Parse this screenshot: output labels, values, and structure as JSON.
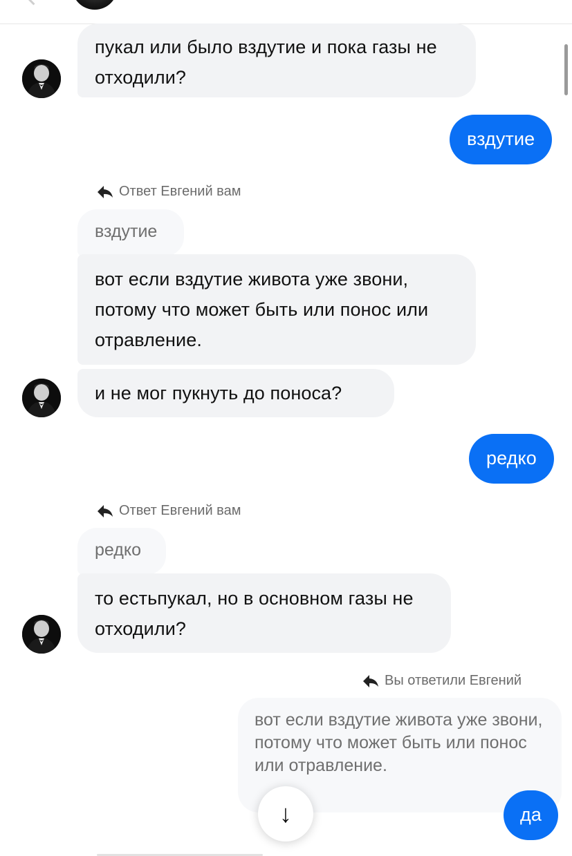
{
  "messages": {
    "m1": "пукал или было вздутие и пока газы не отходили?",
    "m2": "вздутие",
    "r1_label": "Ответ Евгений вам",
    "r1_quote": "вздутие",
    "m3": "вот если вздутие живота уже звони, потому что может быть или понос или отравление.",
    "m4": "и не мог пукнуть до поноса?",
    "m5": "редко",
    "r2_label": "Ответ Евгений вам",
    "r2_quote": "редко",
    "m6": "то естьпукал, но в основном газы не отходили?",
    "r3_label": "Вы ответили Евгений",
    "r3_quote": "вот если вздутие живота уже звони, потому что может быть или понос или отравление.",
    "m7": "да"
  },
  "icons": {
    "reply": "reply-arrow-icon",
    "scroll_down": "arrow-down-icon",
    "avatar": "contact-avatar"
  },
  "colors": {
    "outgoing": "#0a70f5",
    "incoming": "#f2f3f5",
    "quote": "#f7f8fa"
  },
  "scroll_down_glyph": "↓"
}
